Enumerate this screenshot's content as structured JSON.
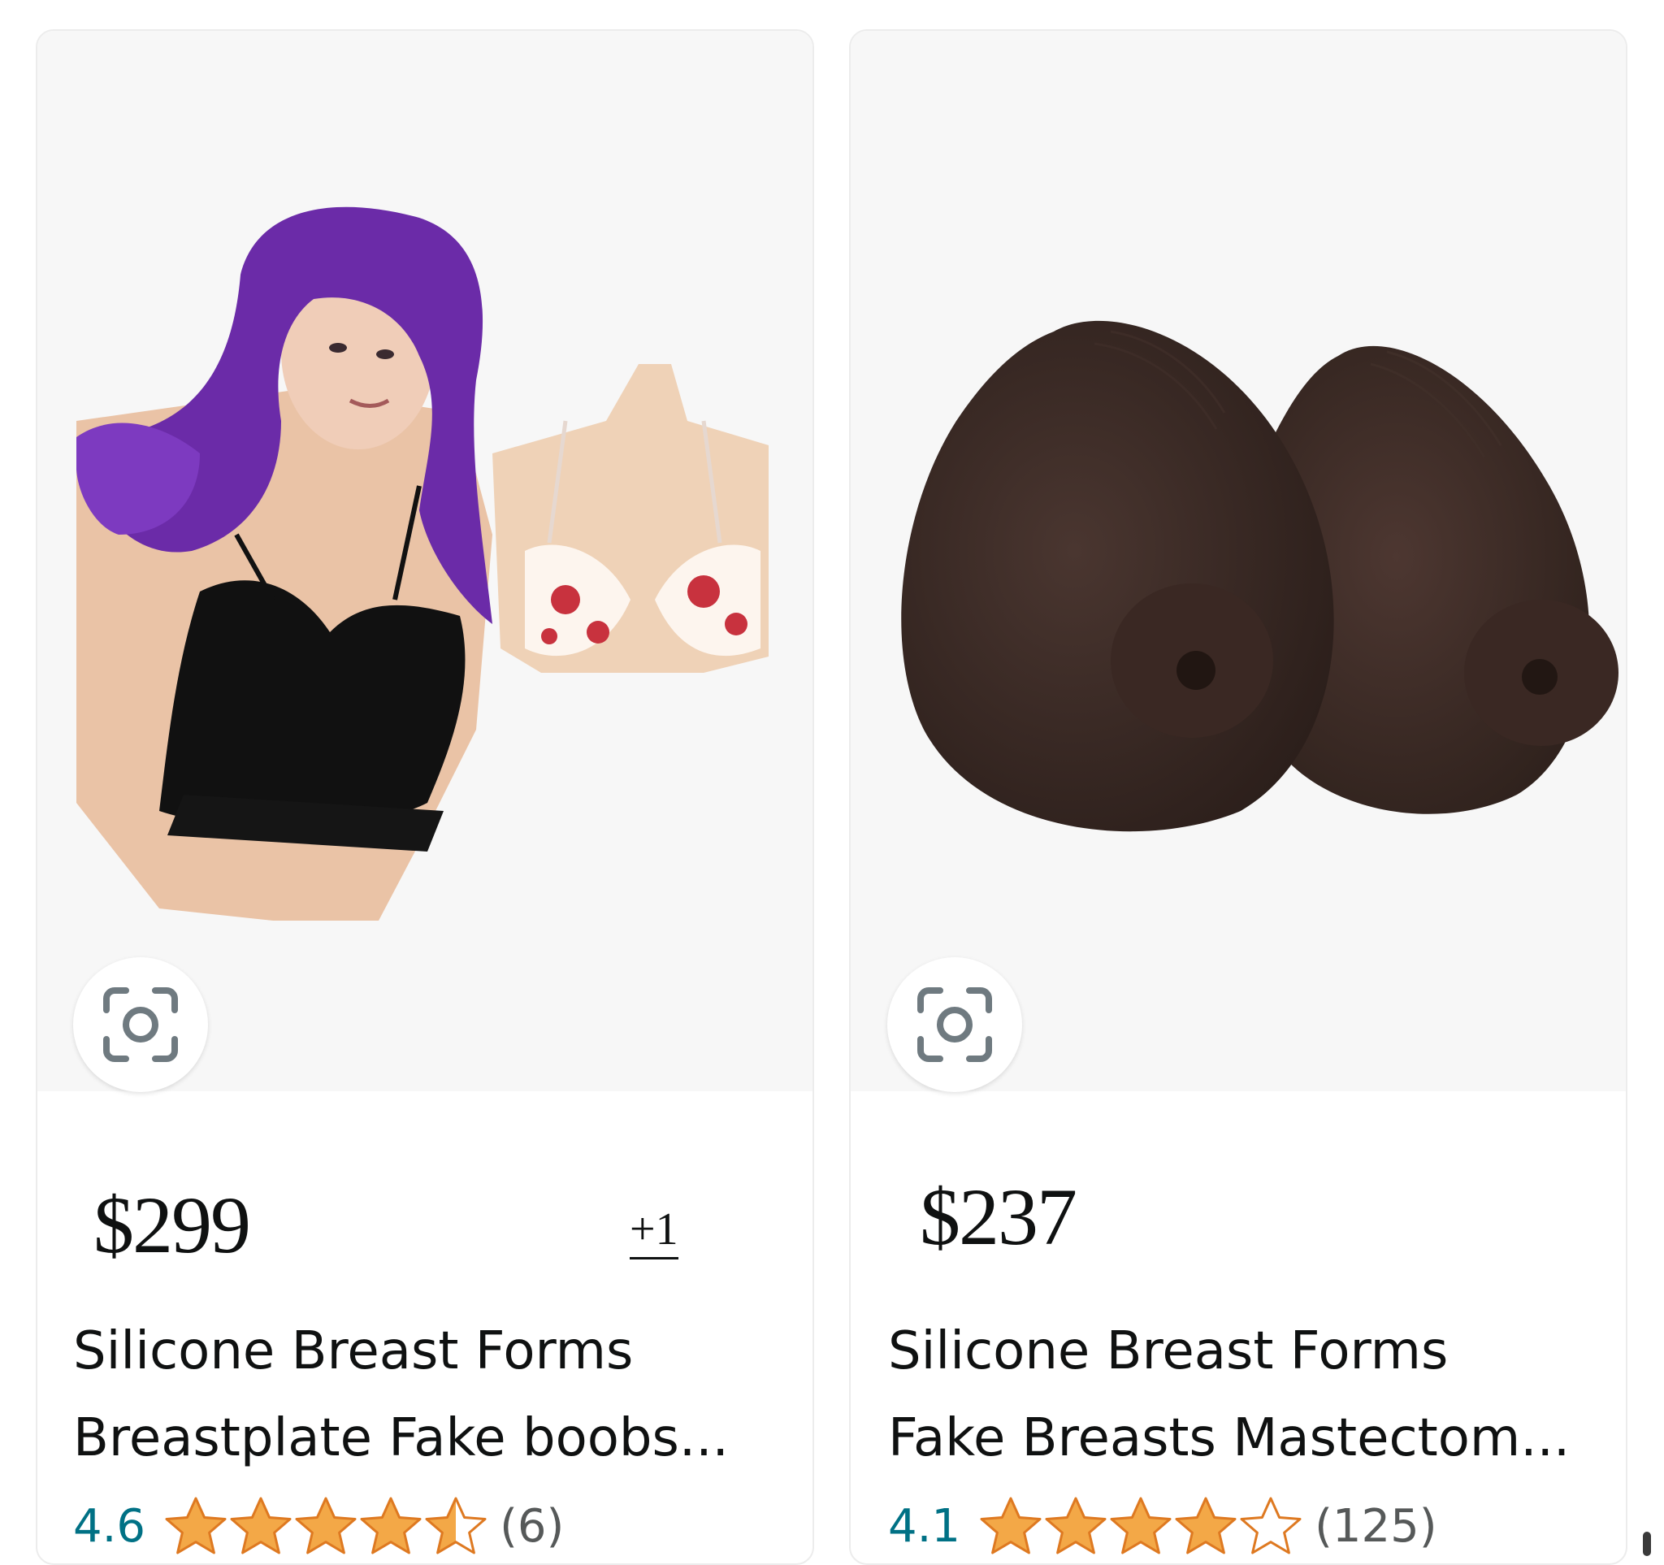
{
  "products": [
    {
      "image_alt": "Silicone breastplate product photo",
      "visual_search_icon": "camera-lens-icon",
      "price": "$299",
      "more_options": "+1",
      "title_line1": "Silicone Breast Forms",
      "title_line2": "Breastplate Fake boobs...",
      "rating": "4.6",
      "stars": 4.6,
      "review_count": "(6)"
    },
    {
      "image_alt": "Dark silicone breast forms product photo",
      "visual_search_icon": "camera-lens-icon",
      "price": "$237",
      "title_line1": "Silicone Breast Forms",
      "title_line2": "Fake Breasts Mastectom...",
      "rating": "4.1",
      "stars": 4.1,
      "review_count": "(125)"
    }
  ],
  "colors": {
    "star_fill": "#f3a847",
    "star_stroke": "#de7921",
    "rating_link": "#007185",
    "text": "#0f1111",
    "image_bg": "#f7f7f7"
  }
}
